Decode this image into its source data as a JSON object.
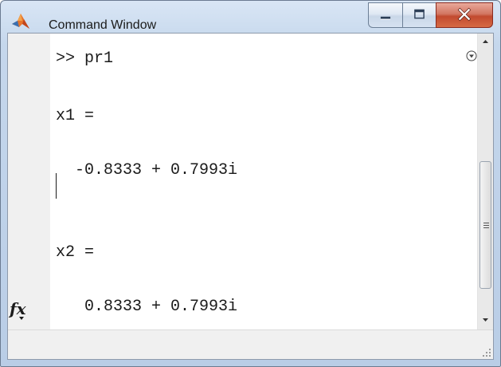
{
  "window": {
    "title": "Command Window",
    "app_icon": "matlab-icon",
    "caption_buttons": [
      "minimize-icon",
      "maximize-icon",
      "close-icon"
    ]
  },
  "console": {
    "lines": [
      ">> pr1",
      "x1 =",
      "  -0.8333 + 0.7993i",
      "x2 =",
      "   0.8333 + 0.7993i"
    ],
    "prompt_icon": "fx"
  },
  "colors": {
    "title_bar": "#c5d7ec",
    "close_button": "#c24a2f",
    "output_bg": "#ffffff",
    "text": "#1b1b1b"
  }
}
